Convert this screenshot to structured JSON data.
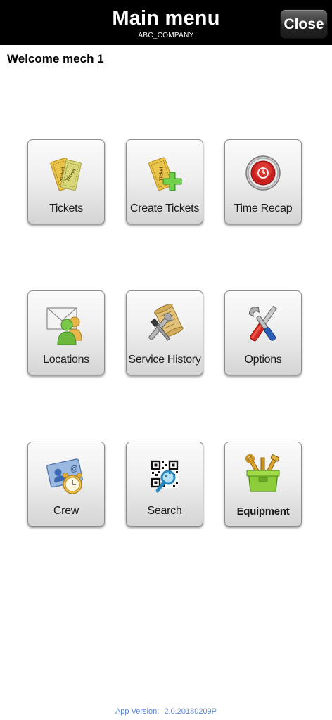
{
  "header": {
    "title": "Main menu",
    "subtitle": "ABC_COMPANY",
    "close_label": "Close"
  },
  "welcome": "Welcome mech 1",
  "menu": {
    "tickets": "Tickets",
    "create_tickets": "Create Tickets",
    "time_recap": "Time Recap",
    "locations": "Locations",
    "service_history": "Service History",
    "options": "Options",
    "crew": "Crew",
    "search": "Search",
    "equipment": "Equipment"
  },
  "icons": {
    "tickets": "ticket-icon",
    "create_tickets": "add-ticket-icon",
    "time_recap": "clock-icon",
    "locations": "contacts-icon",
    "service_history": "scroll-tools-icon",
    "options": "tools-icon",
    "crew": "crew-card-clock-icon",
    "search": "qr-search-icon",
    "equipment": "toolbox-icon"
  },
  "footer": {
    "version_label": "App Version:",
    "version_value": "2.0.20180209P"
  },
  "colors": {
    "header_bg": "#000000",
    "version_text": "#5b87d6"
  }
}
